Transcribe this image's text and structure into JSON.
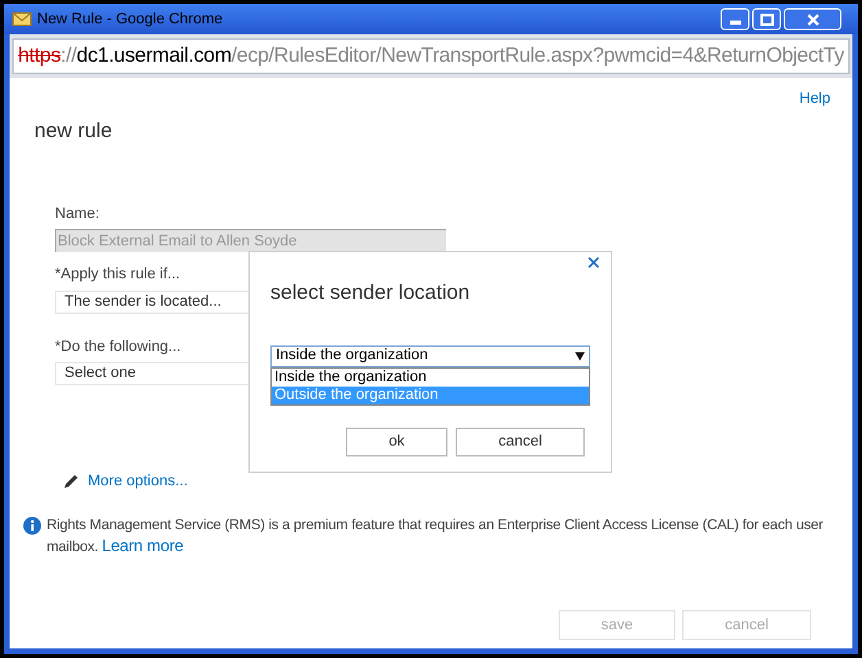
{
  "window": {
    "title": "New Rule - Google Chrome"
  },
  "address_bar": {
    "scheme": "https",
    "scheme_insecure": true,
    "separator": "://",
    "host": "dc1.usermail.com",
    "path": "/ecp/RulesEditor/NewTransportRule.aspx?pwmcid=4&ReturnObjectTy"
  },
  "help_link": "Help",
  "page_title": "new rule",
  "form": {
    "fields": [
      {
        "label": "Name:",
        "value": "Block External Email to Allen Soyde",
        "disabled": true
      },
      {
        "label": "*Apply this rule if...",
        "value": "The sender is located...",
        "disabled": false
      },
      {
        "label": "*Do the following...",
        "value": "Select one",
        "disabled": false
      }
    ],
    "more_options": "More options..."
  },
  "info": {
    "text": "Rights Management Service (RMS) is a premium feature that requires an Enterprise Client Access License (CAL) for each user mailbox.",
    "link": "Learn more"
  },
  "footer_buttons": [
    {
      "label": "save",
      "disabled": true
    },
    {
      "label": "cancel",
      "disabled": true
    }
  ],
  "dialog": {
    "title": "select sender location",
    "select": {
      "value": "Inside the organization",
      "expanded": true,
      "options": [
        {
          "label": "Inside the organization",
          "highlighted": false
        },
        {
          "label": "Outside the organization",
          "highlighted": true
        }
      ]
    },
    "buttons": [
      "ok",
      "cancel"
    ]
  }
}
